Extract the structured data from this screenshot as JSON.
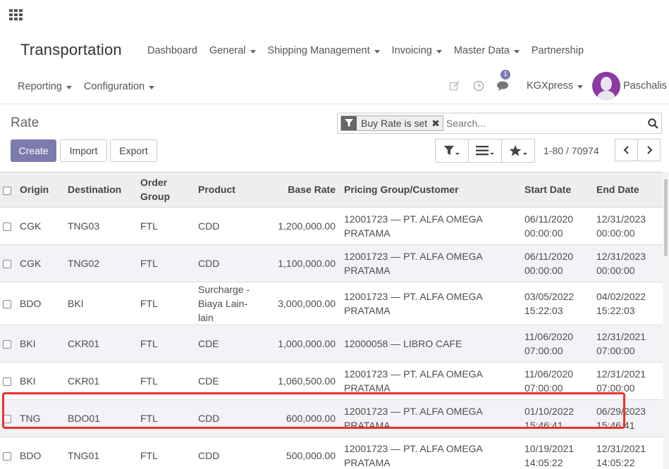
{
  "app": {
    "title": "Transportation"
  },
  "menu": {
    "row1": [
      {
        "label": "Dashboard",
        "dropdown": false
      },
      {
        "label": "General",
        "dropdown": true
      },
      {
        "label": "Shipping Management",
        "dropdown": true
      },
      {
        "label": "Invoicing",
        "dropdown": true
      },
      {
        "label": "Master Data",
        "dropdown": true
      },
      {
        "label": "Partnership",
        "dropdown": false
      }
    ],
    "row2": [
      {
        "label": "Reporting",
        "dropdown": true
      },
      {
        "label": "Configuration",
        "dropdown": true
      }
    ]
  },
  "systray": {
    "messages_count": "1",
    "company": "KGXpress",
    "user": "Paschalis"
  },
  "control": {
    "title": "Rate",
    "create": "Create",
    "import": "Import",
    "export": "Export",
    "facet": "Buy Rate is set",
    "search_placeholder": "Search...",
    "pager": "1-80 / 70974"
  },
  "table": {
    "columns": [
      "Origin",
      "Destination",
      "Order Group",
      "Product",
      "Base Rate",
      "Pricing Group/Customer",
      "Start Date",
      "End Date"
    ],
    "rows": [
      [
        "CGK",
        "TNG03",
        "FTL",
        "CDD",
        "1,200,000.00",
        "12001723 — PT. ALFA OMEGA PRATAMA",
        "06/11/2020 00:00:00",
        "12/31/2023 00:00:00"
      ],
      [
        "CGK",
        "TNG02",
        "FTL",
        "CDD",
        "1,100,000.00",
        "12001723 — PT. ALFA OMEGA PRATAMA",
        "06/11/2020 00:00:00",
        "12/31/2023 00:00:00"
      ],
      [
        "BDO",
        "BKI",
        "FTL",
        "Surcharge - Biaya Lain-lain",
        "3,000,000.00",
        "12001723 — PT. ALFA OMEGA PRATAMA",
        "03/05/2022 15:22:03",
        "04/02/2022 15:22:03"
      ],
      [
        "BKI",
        "CKR01",
        "FTL",
        "CDE",
        "1,000,000.00",
        "12000058 — LIBRO CAFE",
        "11/06/2020 07:00:00",
        "12/31/2021 07:00:00"
      ],
      [
        "BKI",
        "CKR01",
        "FTL",
        "CDE",
        "1,060,500.00",
        "12001723 — PT. ALFA OMEGA PRATAMA",
        "11/06/2020 07:00:00",
        "12/31/2021 07:00:00"
      ],
      [
        "TNG",
        "BDO01",
        "FTL",
        "CDD",
        "600,000.00",
        "12001723 — PT. ALFA OMEGA PRATAMA",
        "01/10/2022 15:46:41",
        "06/29/2023 15:46:41"
      ],
      [
        "BDO",
        "TNG01",
        "FTL",
        "CDD",
        "500,000.00",
        "12001723 — PT. ALFA OMEGA PRATAMA",
        "10/19/2021 14:05:22",
        "12/31/2021 14:05:22"
      ]
    ]
  },
  "colors": {
    "primary": "#7c7bad",
    "highlight": "#e8332a",
    "avatar": "#8b3aa2"
  }
}
